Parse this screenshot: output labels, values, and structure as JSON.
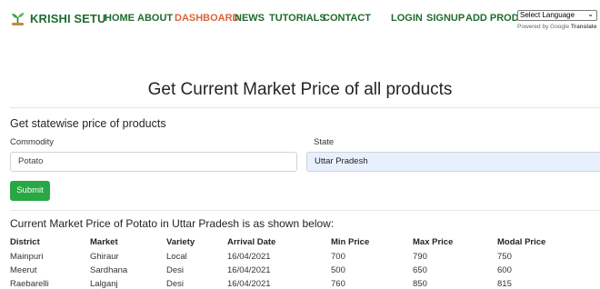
{
  "navbar": {
    "brand": "KRISHI SETU",
    "brand_icon": "sprout-icon",
    "links": [
      "HOME",
      "ABOUT",
      "DASHBOARD",
      "NEWS",
      "TUTORIALS",
      "CONTACT"
    ],
    "active_link": "DASHBOARD",
    "auth_links": [
      "LOGIN",
      "SIGNUP",
      "ADD PRODUCT"
    ]
  },
  "translate": {
    "select_label": "Select Language",
    "powered_prefix": "Powered by",
    "google": "Google",
    "translate_word": "Translate"
  },
  "page_title": "Get Current Market Price of all products",
  "form": {
    "section_title": "Get statewise price of products",
    "commodity_label": "Commodity",
    "commodity_value": "Potato",
    "state_label": "State",
    "state_value": "Uttar Pradesh",
    "submit_label": "Submit"
  },
  "results": {
    "title": "Current Market Price of Potato in Uttar Pradesh is as shown below:",
    "columns": [
      "District",
      "Market",
      "Variety",
      "Arrival Date",
      "Min Price",
      "Max Price",
      "Modal Price"
    ],
    "rows": [
      [
        "Mainpuri",
        "Ghiraur",
        "Local",
        "16/04/2021",
        "700",
        "790",
        "750"
      ],
      [
        "Meerut",
        "Sardhana",
        "Desi",
        "16/04/2021",
        "500",
        "650",
        "600"
      ],
      [
        "Raebarelli",
        "Lalganj",
        "Desi",
        "16/04/2021",
        "760",
        "850",
        "815"
      ]
    ]
  },
  "colors": {
    "brand_green": "#1e6b2f",
    "active_orange": "#d9643a",
    "button_green": "#28a745",
    "autofill_blue": "#e8f0fe"
  }
}
